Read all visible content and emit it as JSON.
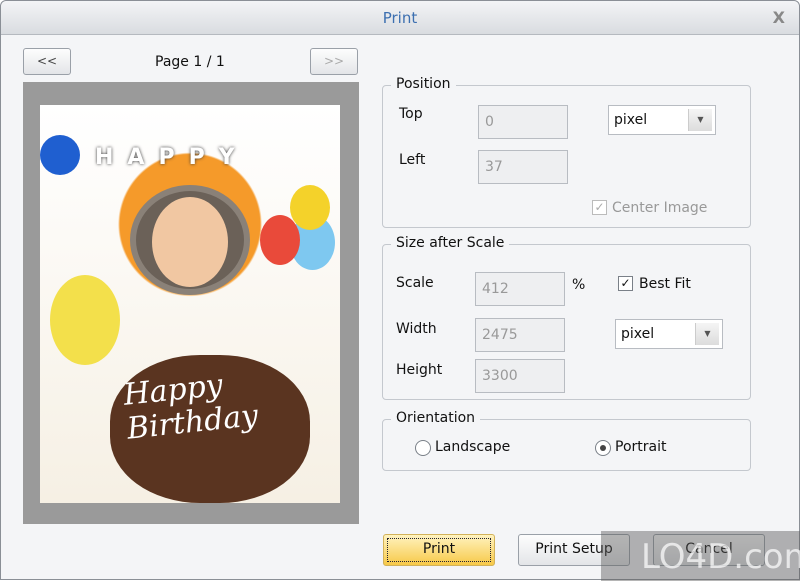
{
  "window": {
    "title": "Print",
    "close_label": "X"
  },
  "nav": {
    "prev_label": "<<",
    "next_label": ">>",
    "page_label": "Page 1 / 1"
  },
  "preview": {
    "image_text": "Happy Birthday",
    "banner_text": "HAPPY"
  },
  "position": {
    "title": "Position",
    "top_label": "Top",
    "top_value": "0",
    "left_label": "Left",
    "left_value": "37",
    "unit": "pixel",
    "center_image_label": "Center Image",
    "center_image_checked": true
  },
  "size": {
    "title": "Size after Scale",
    "scale_label": "Scale",
    "scale_value": "412",
    "percent": "%",
    "best_fit_label": "Best Fit",
    "best_fit_checked": true,
    "width_label": "Width",
    "width_value": "2475",
    "height_label": "Height",
    "height_value": "3300",
    "unit": "pixel"
  },
  "orientation": {
    "title": "Orientation",
    "landscape_label": "Landscape",
    "portrait_label": "Portrait",
    "selected": "Portrait"
  },
  "buttons": {
    "print": "Print",
    "print_setup": "Print Setup",
    "cancel": "Cancel"
  },
  "watermark": "LO4D.com"
}
